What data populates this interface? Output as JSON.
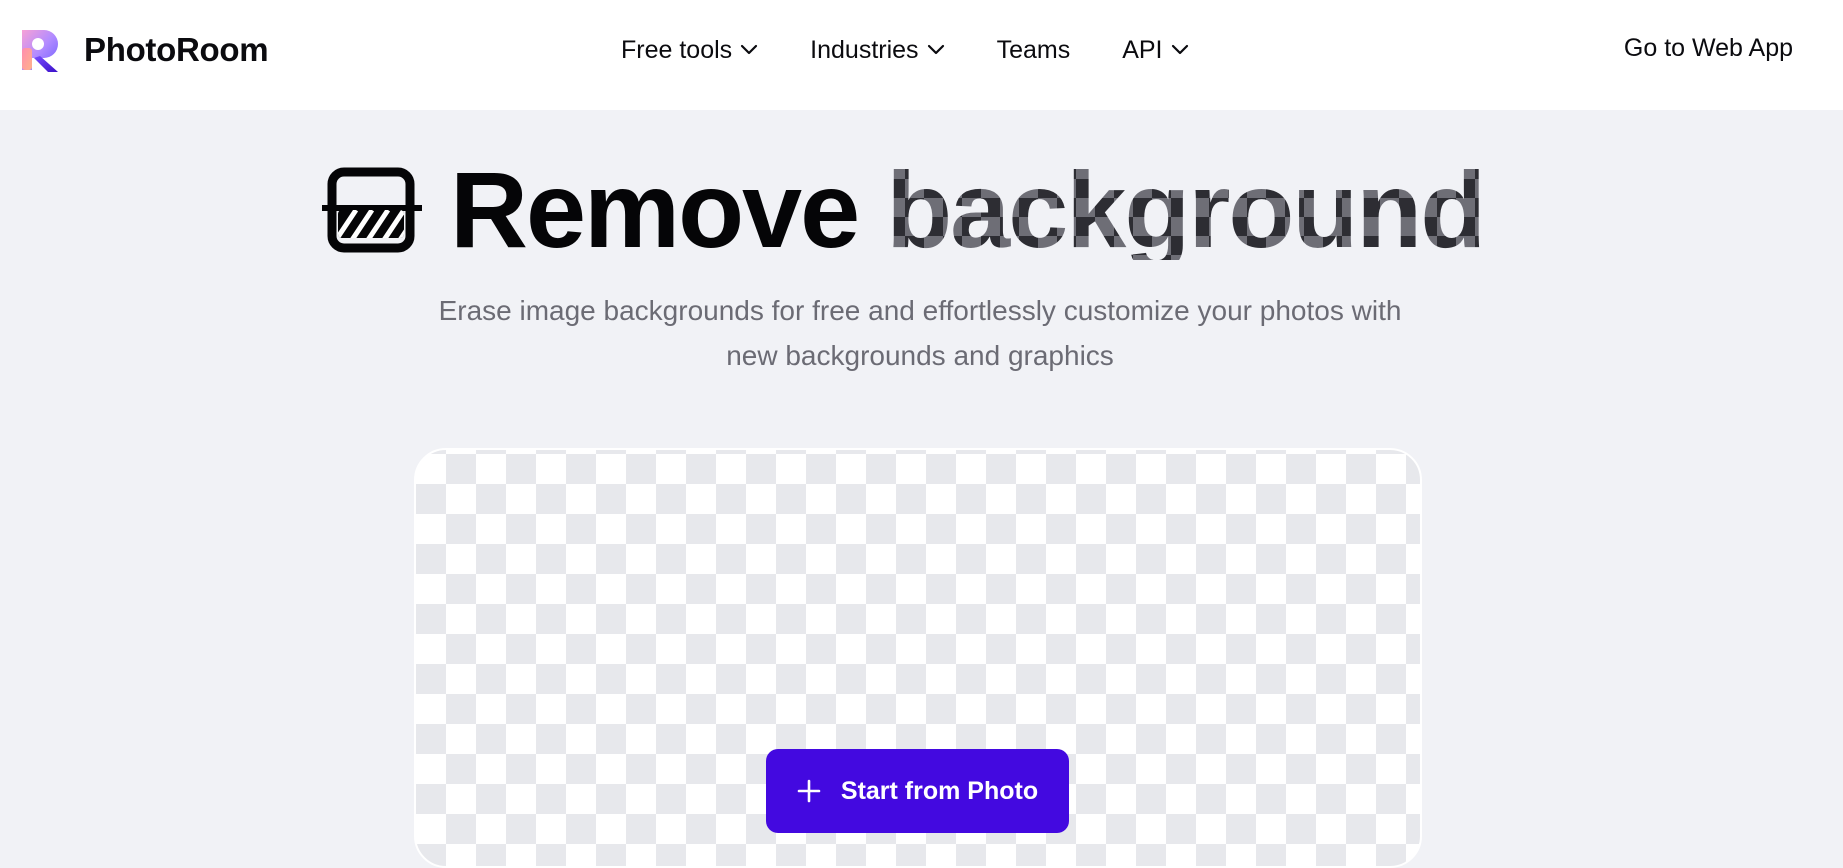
{
  "header": {
    "brand_name": "PhotoRoom",
    "nav": [
      {
        "label": "Free tools",
        "has_dropdown": true
      },
      {
        "label": "Industries",
        "has_dropdown": true
      },
      {
        "label": "Teams",
        "has_dropdown": false
      },
      {
        "label": "API",
        "has_dropdown": true
      }
    ],
    "cta_label": "Go to Web App"
  },
  "hero": {
    "title_word_1": "Remove",
    "title_word_2": "background",
    "subtitle_line_1": "Erase image backgrounds for free and effortlessly customize your photos with",
    "subtitle_line_2": "new backgrounds and graphics"
  },
  "upload": {
    "button_label": "Start from Photo",
    "button_icon": "plus-icon"
  },
  "colors": {
    "page_bg": "#f1f2f6",
    "header_bg": "#ffffff",
    "primary_button": "#4309e0",
    "subtitle_text": "#6b6b74",
    "checker_light": "#ffffff",
    "checker_dark": "#e7e8ec"
  }
}
